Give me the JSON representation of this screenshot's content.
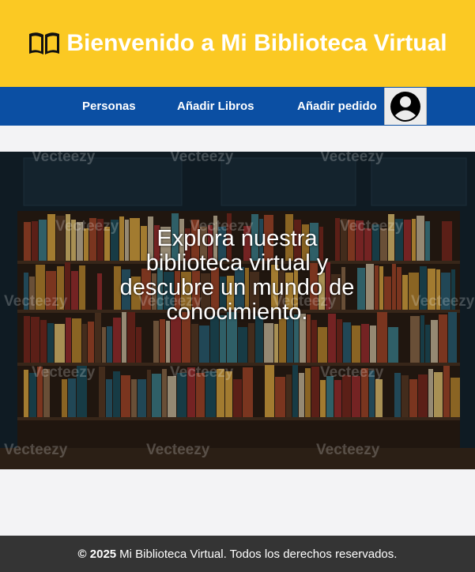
{
  "header": {
    "title": "Bienvenido a Mi Biblioteca Virtual",
    "icon": "open-book-icon",
    "background": "#fbc923"
  },
  "nav": {
    "background": "#0b4fa3",
    "items": [
      {
        "label": "Personas"
      },
      {
        "label": "Añadir Libros"
      },
      {
        "label": "Añadir pedido"
      }
    ],
    "profile_icon": "user-avatar-icon"
  },
  "hero": {
    "text": "Explora nuestra biblioteca virtual y descubre un mundo de conocimiento.",
    "image": "bookshelf-photo",
    "watermark": "Vecteezy"
  },
  "footer": {
    "copyright": "© 2025",
    "text": "Mi Biblioteca Virtual. Todos los derechos reservados.",
    "background": "#343434"
  }
}
